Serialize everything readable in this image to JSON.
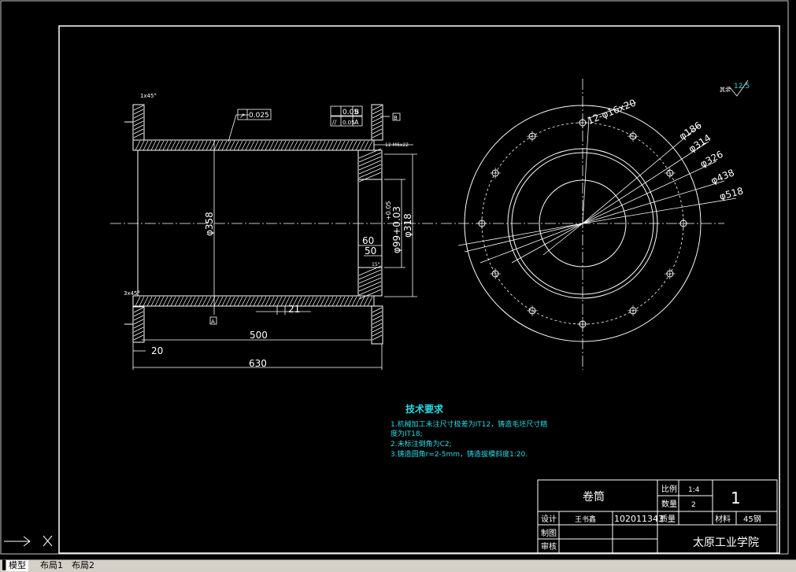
{
  "tabs": {
    "model": "模型",
    "layout1": "布局1",
    "layout2": "布局2"
  },
  "colors": {
    "background": "#000000",
    "lines": "#ffffff",
    "notes": "#2bd9e6",
    "frame": "#c8c8c8"
  },
  "drawing": {
    "chamfer_top": "1x45°",
    "chamfer_bottom": "3x45°",
    "runout_tol": "0.025",
    "parallel_tol": "0.05",
    "datum_b": "B",
    "datum_a": "A",
    "fcf_left_value": "0.05",
    "thread_note": "12-M6x22",
    "dia_358": "φ358",
    "dia_99": "φ99+0.03",
    "dia_99_tol": "+0.05",
    "dia_318": "φ318",
    "dim_60": "60",
    "dim_50": "50",
    "dim_21": "21",
    "dim_500": "500",
    "dim_20": "20",
    "dim_630": "630",
    "angle_15": "15°",
    "holes": "12-φ16x20",
    "d186": "φ186",
    "d314": "φ314",
    "d326": "φ326",
    "d438": "φ438",
    "d518": "φ518",
    "roughness": "12.5",
    "roughness_prefix": "其余"
  },
  "notes": {
    "title": "技术要求",
    "line1": "1.机械加工未注尺寸极差为IT12，铸造毛坯尺寸精",
    "line1b": "度为IT18;",
    "line2": "2.未标注倒角为C2;",
    "line3": "3.铸造圆角r=2-5mm，铸造拔模斜度1:20."
  },
  "title_block": {
    "part_name": "卷筒",
    "scale_label": "比例",
    "scale_value": "1:4",
    "sheet_number": "1",
    "qty_label": "数量",
    "qty_value": "2",
    "design_label": "设计",
    "designer": "王书鑫",
    "student_id": "102011343",
    "mass_label": "质量",
    "material_label": "材料",
    "material_value": "45钢",
    "drawn_label": "制图",
    "check_label": "审核",
    "school": "太原工业学院"
  }
}
